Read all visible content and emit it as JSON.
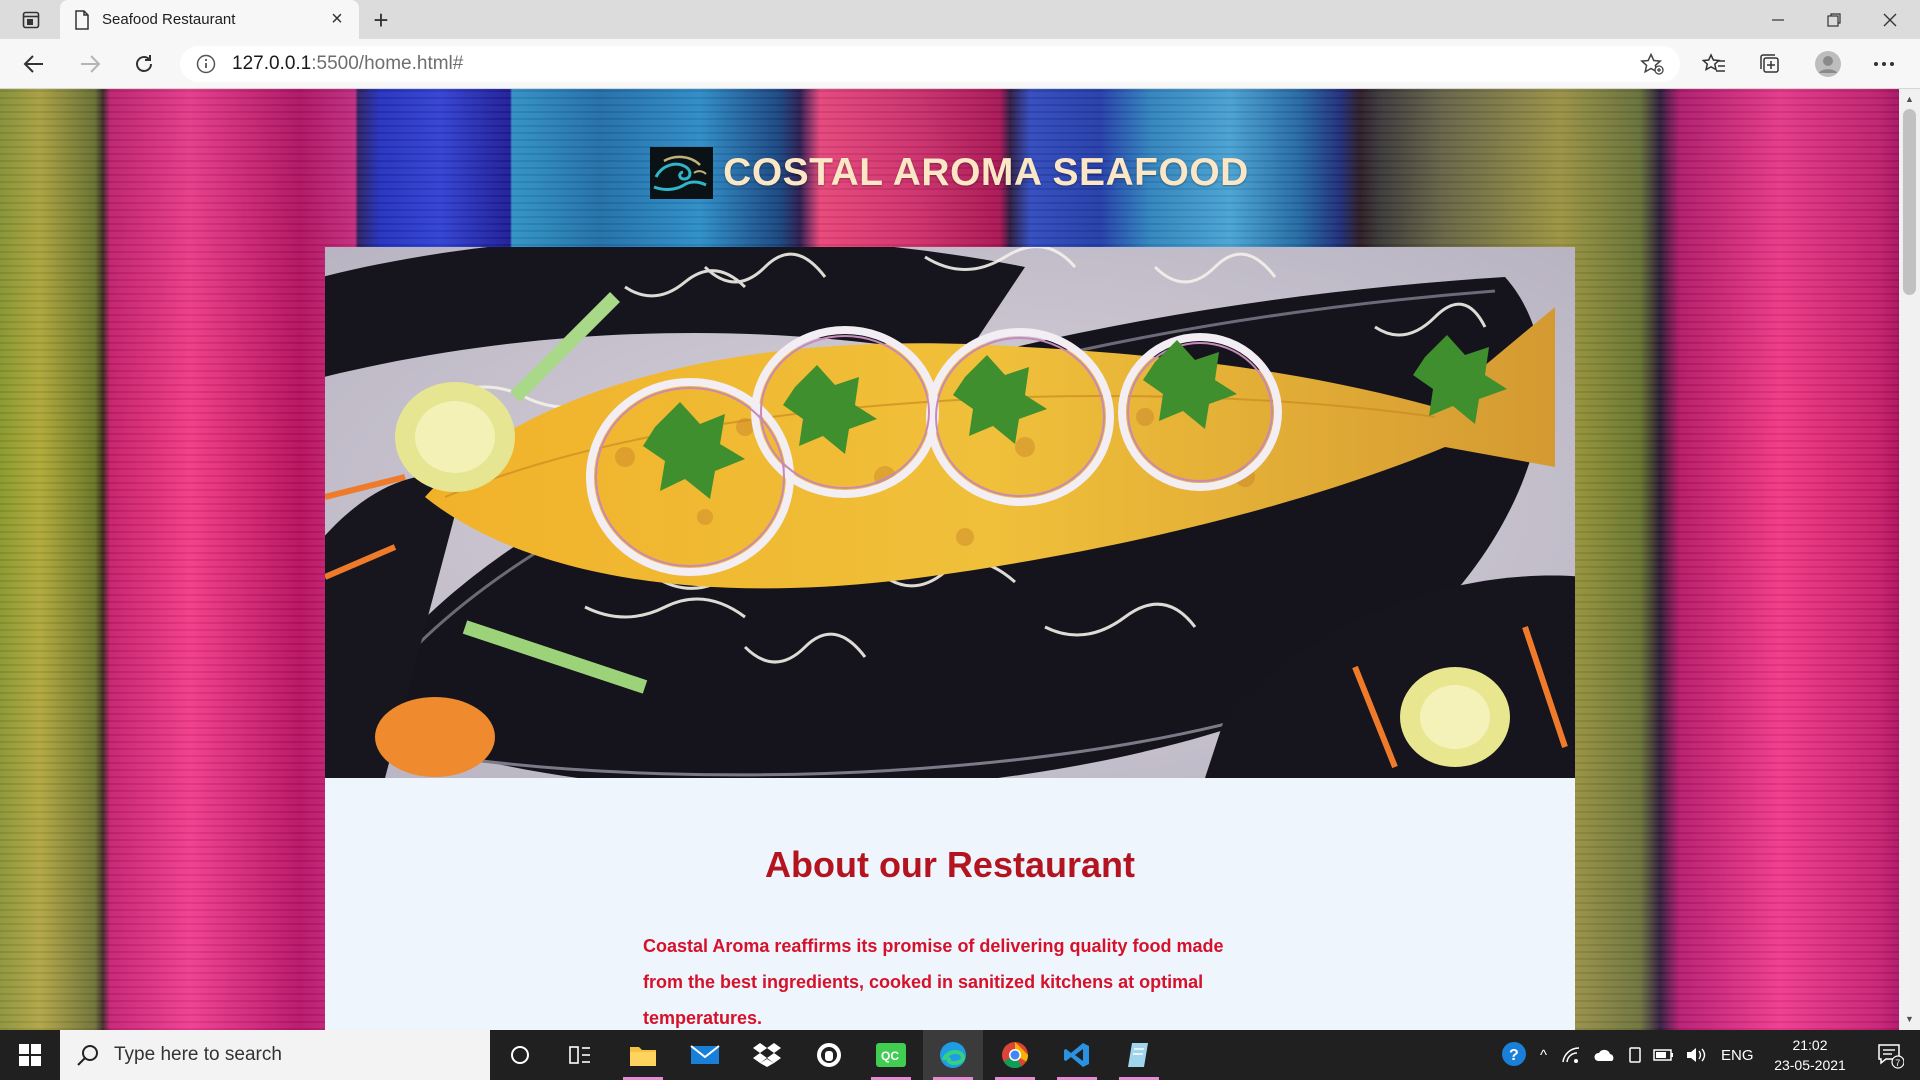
{
  "browser": {
    "tab_title": "Seafood Restaurant",
    "url_host": "127.0.0.1",
    "url_path": ":5500/home.html#"
  },
  "page": {
    "site_title": "COSTAL AROMA SEAFOOD",
    "about_heading": "About our Restaurant",
    "about_text": "Coastal Aroma reaffirms its promise of delivering quality food made from the best ingredients, cooked in sanitized kitchens at optimal temperatures."
  },
  "taskbar": {
    "search_placeholder": "Type here to search",
    "language": "ENG",
    "time": "21:02",
    "date": "23-05-2021",
    "notification_count": "7"
  },
  "colors": {
    "title": "#fbe6c6",
    "about_heading": "#b3141f",
    "about_text": "#d6112a",
    "about_bg": "#eef5fd"
  }
}
